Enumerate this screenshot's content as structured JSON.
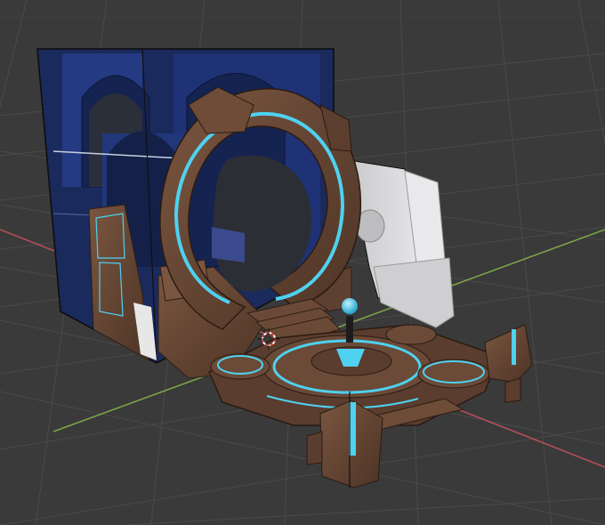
{
  "viewport": {
    "name": "3D Viewport",
    "colors": {
      "background": "#3a3a3a",
      "grid": "#4a4a4a",
      "x_axis": "#b9505a",
      "y_axis": "#7fa64a",
      "prop_brown": "#6b4a38",
      "prop_brown_dark": "#4a3226",
      "glow_cyan": "#4fd1f0",
      "wall_blue": "#1c2f6a",
      "panel_white": "#d9d9dc",
      "selection_outline": "#101010",
      "cursor_red": "#e0413a"
    }
  },
  "scene_objects": [
    "back-wall-mesh",
    "stone-portal-ring",
    "side-panel-mesh",
    "circular-platform",
    "portal-steps",
    "control-pedestal",
    "front-pillar",
    "right-pillar",
    "3d-cursor"
  ]
}
